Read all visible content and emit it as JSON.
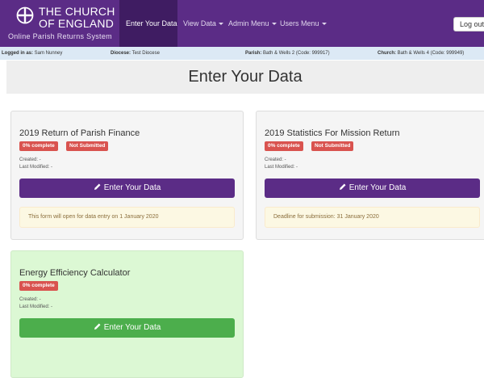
{
  "brand": {
    "line1": "THE CHURCH",
    "line2": "OF ENGLAND",
    "line3": "Online Parish Returns System"
  },
  "nav": {
    "items": [
      {
        "label": "Enter Your Data"
      },
      {
        "label": "View Data"
      },
      {
        "label": "Admin Menu"
      },
      {
        "label": "Users Menu"
      }
    ],
    "logout": "Log out"
  },
  "info": {
    "logged_label": "Logged in as:",
    "logged_value": "Sam Nunney",
    "diocese_label": "Diocese:",
    "diocese_value": "Test Diocese",
    "parish_label": "Parish:",
    "parish_value": "Bath & Wells 2 (Code: 999917)",
    "church_label": "Church:",
    "church_value": "Bath & Wells 4 (Code: 999949)"
  },
  "page_title": "Enter Your Data",
  "cards": [
    {
      "title": "2019 Return of Parish Finance",
      "badge_complete": "0% complete",
      "badge_status": "Not Submitted",
      "created": "Created: -",
      "modified": "Last Modified: -",
      "button": "Enter Your Data",
      "notice": "This form will open for data entry on 1 January 2020"
    },
    {
      "title": "2019 Statistics For Mission Return",
      "badge_complete": "0% complete",
      "badge_status": "Not Submitted",
      "created": "Created: -",
      "modified": "Last Modified: -",
      "button": "Enter Your Data",
      "notice": "Deadline for submission: 31 January 2020"
    },
    {
      "title": "Energy Efficiency Calculator",
      "badge_complete": "0% complete",
      "created": "Created: -",
      "modified": "Last Modified: -",
      "button": "Enter Your Data"
    }
  ],
  "colors": {
    "nav_bg": "#5b2c86",
    "badge_red": "#d9534f",
    "button_green": "#4cae4c"
  }
}
